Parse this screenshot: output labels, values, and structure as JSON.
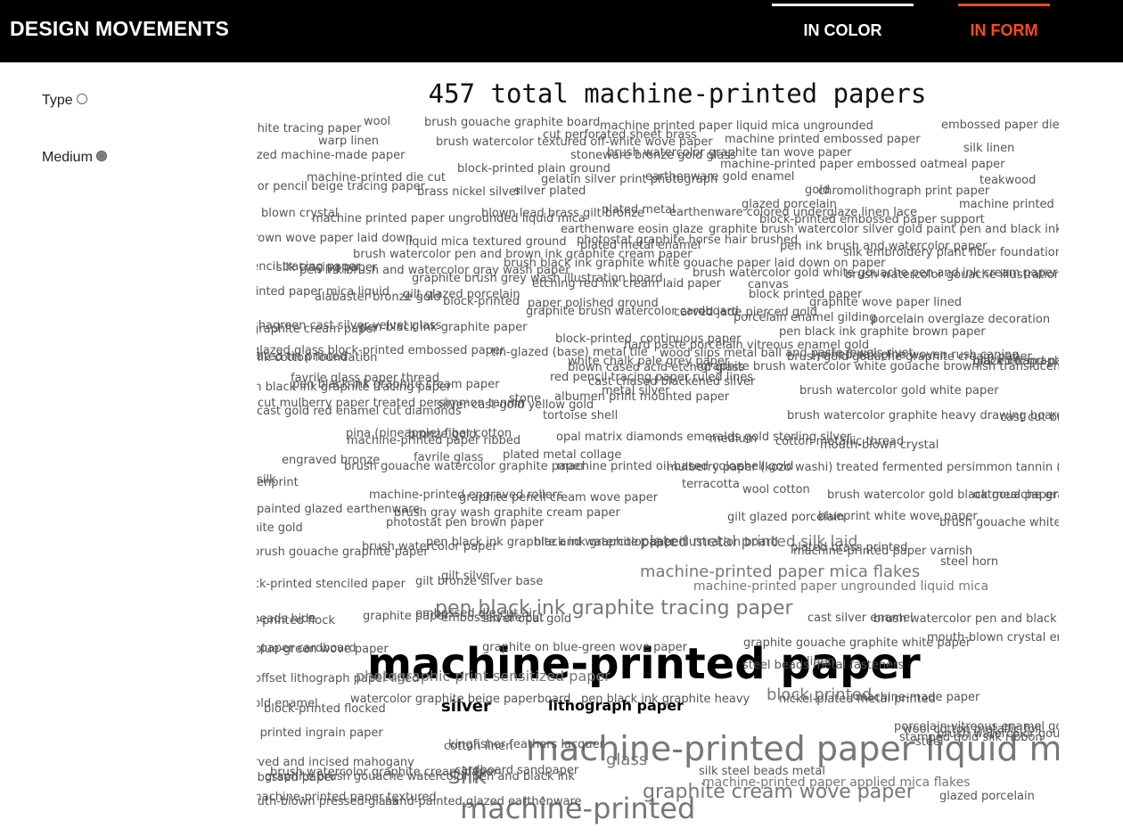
{
  "header": {
    "brand": "DESIGN MOVEMENTS",
    "tabs": [
      {
        "label": "IN COLOR",
        "accent": "#ffffff"
      },
      {
        "label": "IN FORM",
        "accent": "#ff4a1c",
        "active": true
      }
    ]
  },
  "controls": {
    "type_label": "Type",
    "medium_label": "Medium",
    "selected": "Medium"
  },
  "cloud": {
    "title": "457 total machine-printed papers",
    "words": [
      {
        "t": "machine-printed paper",
        "s": 48,
        "c": "#000",
        "b": true
      },
      {
        "t": "machine-printed paper liquid mica",
        "s": 38,
        "c": "#777"
      },
      {
        "t": "machine-printed",
        "s": 32,
        "c": "#777"
      },
      {
        "t": "pen black ink graphite tracing paper",
        "s": 22,
        "c": "#777"
      },
      {
        "t": "graphite cream wove paper",
        "s": 22,
        "c": "#777"
      },
      {
        "t": "silk",
        "s": 26,
        "c": "#777"
      },
      {
        "t": "silver",
        "s": 18,
        "c": "#000",
        "b": true
      },
      {
        "t": "lithograph paper",
        "s": 16,
        "c": "#000",
        "b": true
      },
      {
        "t": "machine-printed paper mica flakes",
        "s": 18,
        "c": "#777"
      },
      {
        "t": "plated metal printed silk laid",
        "s": 17,
        "c": "#777"
      },
      {
        "t": "block printed",
        "s": 18,
        "c": "#777"
      },
      {
        "t": "glass",
        "s": 18,
        "c": "#777"
      },
      {
        "t": "machine-printed paper ungrounded liquid mica",
        "s": 14,
        "c": "#777"
      },
      {
        "t": "brush gouache graphite board",
        "s": 13,
        "c": "#555"
      },
      {
        "t": "machine printed paper liquid mica ungrounded",
        "s": 13,
        "c": "#555"
      },
      {
        "t": "embossed paper die cut",
        "s": 13,
        "c": "#555"
      },
      {
        "t": "white tracing paper",
        "s": 13,
        "c": "#555"
      },
      {
        "t": "wool",
        "s": 13,
        "c": "#555"
      },
      {
        "t": "cut perforated sheet brass",
        "s": 13,
        "c": "#555"
      },
      {
        "t": "machine printed embossed paper",
        "s": 13,
        "c": "#555"
      },
      {
        "t": "warp linen",
        "s": 13,
        "c": "#555"
      },
      {
        "t": "brush watercolor textured off-white wove paper",
        "s": 13,
        "c": "#555"
      },
      {
        "t": "silk linen",
        "s": 13,
        "c": "#555"
      },
      {
        "t": "glazed machine-made paper",
        "s": 13,
        "c": "#555"
      },
      {
        "t": "stoneware bronze gold glass",
        "s": 13,
        "c": "#555"
      },
      {
        "t": "brush watercolor graphite tan wove paper",
        "s": 13,
        "c": "#555"
      },
      {
        "t": "machine-printed paper embossed oatmeal paper",
        "s": 13,
        "c": "#555"
      },
      {
        "t": "machine-printed die cut",
        "s": 13,
        "c": "#555"
      },
      {
        "t": "block-printed plain ground",
        "s": 13,
        "c": "#555"
      },
      {
        "t": "teakwood",
        "s": 13,
        "c": "#555"
      },
      {
        "t": "color pencil beige tracing paper",
        "s": 13,
        "c": "#555"
      },
      {
        "t": "gelatin silver print photograph",
        "s": 13,
        "c": "#555"
      },
      {
        "t": "earthenware gold enamel",
        "s": 13,
        "c": "#555"
      },
      {
        "t": "brass nickel silver",
        "s": 13,
        "c": "#555"
      },
      {
        "t": "silver plated",
        "s": 13,
        "c": "#555"
      },
      {
        "t": "gold",
        "s": 13,
        "c": "#555"
      },
      {
        "t": "chromolithograph print paper",
        "s": 13,
        "c": "#555"
      },
      {
        "t": "machine printed paper mica",
        "s": 13,
        "c": "#555"
      },
      {
        "t": "glazed porcelain",
        "s": 13,
        "c": "#555"
      },
      {
        "t": "plated metal",
        "s": 13,
        "c": "#555"
      },
      {
        "t": "earthenware colored underglaze linen lace",
        "s": 13,
        "c": "#555"
      },
      {
        "t": "blown crystal",
        "s": 13,
        "c": "#555"
      },
      {
        "t": "machine printed paper ungrounded liquid mica",
        "s": 13,
        "c": "#555"
      },
      {
        "t": "blown lead brass gilt bronze",
        "s": 13,
        "c": "#555"
      },
      {
        "t": "block-printed embossed paper support",
        "s": 13,
        "c": "#555"
      },
      {
        "t": "earthenware eosin glaze",
        "s": 13,
        "c": "#555"
      },
      {
        "t": "graphite brush watercolor silver gold paint pen and black ink",
        "s": 13,
        "c": "#555"
      },
      {
        "t": "brown wove paper laid down",
        "s": 13,
        "c": "#555"
      },
      {
        "t": "liquid mica textured ground",
        "s": 13,
        "c": "#555"
      },
      {
        "t": "photostat graphite horse hair brushed",
        "s": 13,
        "c": "#555"
      },
      {
        "t": "pen ink brush and watercolor paper",
        "s": 13,
        "c": "#555"
      },
      {
        "t": "brush watercolor pen and brown ink graphite cream paper",
        "s": 13,
        "c": "#555"
      },
      {
        "t": "silk embroidery plant fiber foundation",
        "s": 13,
        "c": "#555"
      },
      {
        "t": "plated metal enamel",
        "s": 13,
        "c": "#555"
      },
      {
        "t": "pencil tracing paper",
        "s": 13,
        "c": "#555"
      },
      {
        "t": "silk tracing paper",
        "s": 13,
        "c": "#555"
      },
      {
        "t": "brush black ink graphite white gouache paper laid down on paper",
        "s": 13,
        "c": "#555"
      },
      {
        "t": "pen ink brush and watercolor gray wash paper",
        "s": 13,
        "c": "#555"
      },
      {
        "t": "brush watercolor gold white gouache pen and ink cream paper",
        "s": 13,
        "c": "#555"
      },
      {
        "t": "graphite brush grey wash illustration board",
        "s": 13,
        "c": "#555"
      },
      {
        "t": "brush watercolor gouache illustration",
        "s": 13,
        "c": "#555"
      },
      {
        "t": "etching red ink cream laid paper",
        "s": 13,
        "c": "#555"
      },
      {
        "t": "canvas",
        "s": 13,
        "c": "#555"
      },
      {
        "t": "printed paper mica liquid",
        "s": 13,
        "c": "#555"
      },
      {
        "t": "gilt glazed porcelain",
        "s": 13,
        "c": "#555"
      },
      {
        "t": "block printed paper",
        "s": 13,
        "c": "#555"
      },
      {
        "t": "graphite wove paper lined",
        "s": 13,
        "c": "#555"
      },
      {
        "t": "alabaster bronze gold",
        "s": 13,
        "c": "#555"
      },
      {
        "t": "block-printed",
        "s": 13,
        "c": "#555"
      },
      {
        "t": "paper polished ground",
        "s": 13,
        "c": "#555"
      },
      {
        "t": "graphite brush watercolor cardboard",
        "s": 13,
        "c": "#555"
      },
      {
        "t": "carved jade pierced gold",
        "s": 13,
        "c": "#555"
      },
      {
        "t": "porcelain enamel gilding",
        "s": 13,
        "c": "#555"
      },
      {
        "t": "porcelain overglaze decoration",
        "s": 13,
        "c": "#555"
      },
      {
        "t": "shagreen cast silver velvet glass",
        "s": 13,
        "c": "#555"
      },
      {
        "t": "graphite cream paper",
        "s": 13,
        "c": "#555"
      },
      {
        "t": "pen black ink graphite paper",
        "s": 13,
        "c": "#555"
      },
      {
        "t": "pen black ink graphite brown paper",
        "s": 13,
        "c": "#555"
      },
      {
        "t": "block-printed",
        "s": 13,
        "c": "#555"
      },
      {
        "t": "continuous paper",
        "s": 13,
        "c": "#555"
      },
      {
        "t": "hard paste porcelain vitreous enamel gold",
        "s": 13,
        "c": "#555"
      },
      {
        "t": "glazed glass block-printed embossed paper",
        "s": 13,
        "c": "#555"
      },
      {
        "t": "tin-glazed (base) metal tile",
        "s": 13,
        "c": "#555"
      },
      {
        "t": "wood slips metal ball and paste jewels rivet",
        "s": 13,
        "c": "#555"
      },
      {
        "t": "silk cotton foundation",
        "s": 13,
        "c": "#555"
      },
      {
        "t": "white chalk pale grey paper",
        "s": 13,
        "c": "#555"
      },
      {
        "t": "joined oak pine woven rush caning",
        "s": 13,
        "c": "#555"
      },
      {
        "t": "black ink graphite brown paper",
        "s": 13,
        "c": "#555"
      },
      {
        "t": "plated tin printed",
        "s": 13,
        "c": "#555"
      },
      {
        "t": "blown cased acid etched glass",
        "s": 13,
        "c": "#555"
      },
      {
        "t": "brush gold gouache graphite cream paper",
        "s": 13,
        "c": "#555"
      },
      {
        "t": "glazed hand-painted stoneware",
        "s": 13,
        "c": "#555"
      },
      {
        "t": "graphite brush watercolor white gouache brownish translucent wove paper",
        "s": 13,
        "c": "#555"
      },
      {
        "t": "favrile glass paper thread",
        "s": 13,
        "c": "#555"
      },
      {
        "t": "red pencil tracing paper ruled lines",
        "s": 13,
        "c": "#555"
      },
      {
        "t": "cast chased blackened silver",
        "s": 13,
        "c": "#555"
      },
      {
        "t": "pen black ink graphite tracing paper",
        "s": 13,
        "c": "#555"
      },
      {
        "t": "pen black ink graphite cream paper",
        "s": 13,
        "c": "#555"
      },
      {
        "t": "metal silver",
        "s": 13,
        "c": "#555"
      },
      {
        "t": "brush watercolor gold white paper",
        "s": 13,
        "c": "#555"
      },
      {
        "t": "albumen print mounted paper",
        "s": 13,
        "c": "#555"
      },
      {
        "t": "stone",
        "s": 13,
        "c": "#555"
      },
      {
        "t": "cut mulberry paper treated persimmon tannin",
        "s": 13,
        "c": "#555"
      },
      {
        "t": "silver cast gold yellow gold",
        "s": 13,
        "c": "#555"
      },
      {
        "t": "cast gold red enamel cut diamonds",
        "s": 13,
        "c": "#555"
      },
      {
        "t": "tortoise shell",
        "s": 13,
        "c": "#555"
      },
      {
        "t": "brush watercolor graphite heavy drawing board",
        "s": 13,
        "c": "#555"
      },
      {
        "t": "cast cut brass",
        "s": 13,
        "c": "#555"
      },
      {
        "t": "pina (pineapple) fiber cotton",
        "s": 13,
        "c": "#555"
      },
      {
        "t": "bronze gold",
        "s": 13,
        "c": "#555"
      },
      {
        "t": "machine-printed paper ribbed",
        "s": 13,
        "c": "#555"
      },
      {
        "t": "opal matrix diamonds emeralds gold sterling silver",
        "s": 13,
        "c": "#555"
      },
      {
        "t": "medium",
        "s": 13,
        "c": "#555"
      },
      {
        "t": "cotton metallic thread",
        "s": 13,
        "c": "#555"
      },
      {
        "t": "mouth-blown crystal",
        "s": 13,
        "c": "#555"
      },
      {
        "t": "engraved bronze",
        "s": 13,
        "c": "#555"
      },
      {
        "t": "favrile glass",
        "s": 13,
        "c": "#555"
      },
      {
        "t": "plated metal collage",
        "s": 13,
        "c": "#555"
      },
      {
        "t": "brush gouache watercolor graphite paper",
        "s": 13,
        "c": "#555"
      },
      {
        "t": "machine printed oil-based color",
        "s": 13,
        "c": "#555"
      },
      {
        "t": "mulberry paper (kozo washi) treated fermented persimmon tannin (kakishibu) silk threads (itoire)",
        "s": 13,
        "c": "#555"
      },
      {
        "t": "shell gold",
        "s": 13,
        "c": "#555"
      },
      {
        "t": "iron silk",
        "s": 13,
        "c": "#555"
      },
      {
        "t": "screenprint",
        "s": 13,
        "c": "#555"
      },
      {
        "t": "machine-printed engraved rollers",
        "s": 13,
        "c": "#555"
      },
      {
        "t": "graphite pencil cream wove paper",
        "s": 13,
        "c": "#555"
      },
      {
        "t": "terracotta",
        "s": 13,
        "c": "#555"
      },
      {
        "t": "wool cotton",
        "s": 13,
        "c": "#555"
      },
      {
        "t": "brush watercolor gold black gouache graphite cream paper",
        "s": 13,
        "c": "#555"
      },
      {
        "t": "oatmeal paper",
        "s": 13,
        "c": "#555"
      },
      {
        "t": "painted glazed earthenware",
        "s": 13,
        "c": "#555"
      },
      {
        "t": "brush gray wash graphite cream paper",
        "s": 13,
        "c": "#555"
      },
      {
        "t": "photostat pen brown paper",
        "s": 13,
        "c": "#555"
      },
      {
        "t": "white gold",
        "s": 13,
        "c": "#555"
      },
      {
        "t": "gilt glazed porcelain",
        "s": 13,
        "c": "#555"
      },
      {
        "t": "blueprint white wove paper",
        "s": 13,
        "c": "#555"
      },
      {
        "t": "brush gouache white paper",
        "s": 13,
        "c": "#555"
      },
      {
        "t": "brush watercolor paper",
        "s": 13,
        "c": "#555"
      },
      {
        "t": "pen black ink graphite and watercolor paper",
        "s": 13,
        "c": "#555"
      },
      {
        "t": "black ink graphite paper illustration board",
        "s": 13,
        "c": "#555"
      },
      {
        "t": "plated brass printed",
        "s": 13,
        "c": "#555"
      },
      {
        "t": "brush gouache graphite paper",
        "s": 13,
        "c": "#555"
      },
      {
        "t": "machine-printed paper varnish",
        "s": 13,
        "c": "#555"
      },
      {
        "t": "steel horn",
        "s": 13,
        "c": "#555"
      },
      {
        "t": "gilt silver",
        "s": 13,
        "c": "#555"
      },
      {
        "t": "gilt bronze silver base",
        "s": 13,
        "c": "#555"
      },
      {
        "t": "block-printed stenciled paper",
        "s": 13,
        "c": "#555"
      },
      {
        "t": "beads hide",
        "s": 13,
        "c": "#555"
      },
      {
        "t": "graphite paper",
        "s": 13,
        "c": "#555"
      },
      {
        "t": "embossed die cut",
        "s": 13,
        "c": "#555"
      },
      {
        "t": "silver opal gold",
        "s": 13,
        "c": "#555"
      },
      {
        "t": "block-printed flock",
        "s": 13,
        "c": "#555"
      },
      {
        "t": "embossed die cut air",
        "s": 13,
        "c": "#555"
      },
      {
        "t": "cast silver enamel",
        "s": 13,
        "c": "#555"
      },
      {
        "t": "blue-green wove paper",
        "s": 13,
        "c": "#555"
      },
      {
        "t": "graphite on blue-green wove paper",
        "s": 13,
        "c": "#555"
      },
      {
        "t": "brush watercolor pen and black ink color chalk graphite",
        "s": 13,
        "c": "#555"
      },
      {
        "t": "linen",
        "s": 13,
        "c": "#555"
      },
      {
        "t": "mouth-blown crystal engraving",
        "s": 13,
        "c": "#555"
      },
      {
        "t": "silk paper cardboard",
        "s": 13,
        "c": "#555"
      },
      {
        "t": "offset lithograph paper lined",
        "s": 13,
        "c": "#555"
      },
      {
        "t": "photographic print sensitized paper",
        "s": 16,
        "c": "#777"
      },
      {
        "t": "steel beads metal fasteners",
        "s": 13,
        "c": "#555"
      },
      {
        "t": "pen black ink graphite heavy",
        "s": 13,
        "c": "#555"
      },
      {
        "t": "machine-made paper",
        "s": 13,
        "c": "#555"
      },
      {
        "t": "gold enamel",
        "s": 13,
        "c": "#555"
      },
      {
        "t": "watercolor graphite beige paperboard",
        "s": 13,
        "c": "#555"
      },
      {
        "t": "block-printed flocked",
        "s": 13,
        "c": "#555"
      },
      {
        "t": "nickel-plated metal printed",
        "s": 13,
        "c": "#555"
      },
      {
        "t": "porcelain vitreous enamel gold",
        "s": 13,
        "c": "#555"
      },
      {
        "t": "brush watercolor gouache cream paper",
        "s": 13,
        "c": "#555"
      },
      {
        "t": "block printed ingrain paper",
        "s": 13,
        "c": "#555"
      },
      {
        "t": "kingfisher feathers lacquer",
        "s": 13,
        "c": "#555"
      },
      {
        "t": "brush watercolor graphite cream paper",
        "s": 13,
        "c": "#555"
      },
      {
        "t": "stamped gold silk ribbon",
        "s": 13,
        "c": "#555"
      },
      {
        "t": "graphite gouache graphite white paper",
        "s": 13,
        "c": "#555"
      },
      {
        "t": "carved and incised mahogany",
        "s": 13,
        "c": "#555"
      },
      {
        "t": "graphite brush gouache watercolor pen and black ink",
        "s": 13,
        "c": "#555"
      },
      {
        "t": "cotton linen",
        "s": 13,
        "c": "#555"
      },
      {
        "t": "wool cotton metallic foil",
        "s": 13,
        "c": "#555"
      },
      {
        "t": "steel",
        "s": 13,
        "c": "#555"
      },
      {
        "t": "silk steel beads metal",
        "s": 13,
        "c": "#555"
      },
      {
        "t": "embossed paper",
        "s": 13,
        "c": "#555"
      },
      {
        "t": "cardboard sandpaper",
        "s": 13,
        "c": "#555"
      },
      {
        "t": "machine-printed paper textured",
        "s": 13,
        "c": "#555"
      },
      {
        "t": "machine-printed paper applied mica flakes",
        "s": 14,
        "c": "#777"
      },
      {
        "t": "mouth-blown pressed glass",
        "s": 13,
        "c": "#555"
      },
      {
        "t": "hand-painted glazed earthenware",
        "s": 13,
        "c": "#555"
      },
      {
        "t": "glazed porcelain",
        "s": 13,
        "c": "#555"
      }
    ]
  }
}
